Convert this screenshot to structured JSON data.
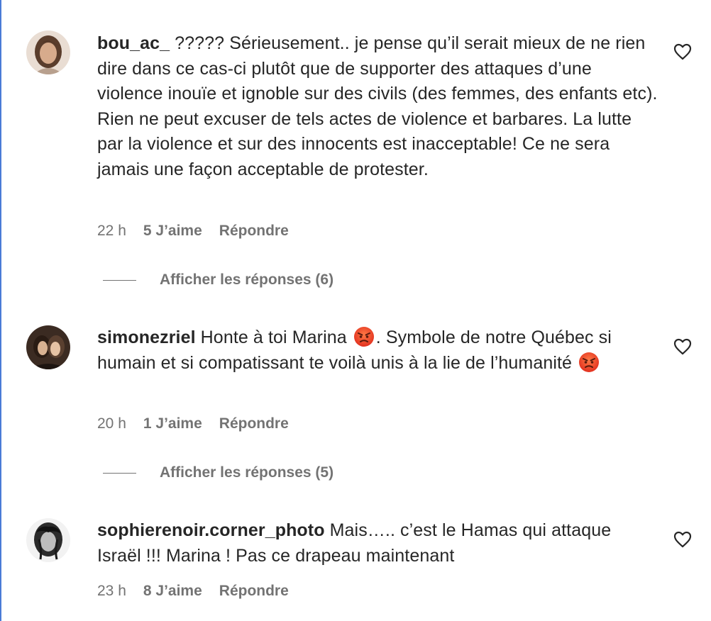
{
  "comments": [
    {
      "username": "bou_ac_",
      "text": "????? Sérieusement.. je pense qu’il serait mieux de ne rien dire dans ce cas-ci plutôt que de supporter des attaques d’une violence inouïe et ignoble sur des civils (des femmes, des enfants etc). Rien ne peut excuser de tels actes de violence et barbares. La lutte par la violence et sur des innocents est inacceptable! Ce ne sera jamais une façon acceptable de protester.",
      "time": "22 h",
      "likes": "5 J’aime",
      "reply": "Répondre",
      "replies_label": "Afficher les réponses (6)"
    },
    {
      "username": "simonezriel",
      "text_part1": "Honte à toi Marina",
      "emoji1": "angry-face",
      "text_part2": ". Symbole de notre Québec si humain et si compatissant te voilà unis à la lie de l’humanité",
      "emoji2": "angry-face",
      "time": "20 h",
      "likes": "1 J’aime",
      "reply": "Répondre",
      "replies_label": "Afficher les réponses (5)"
    },
    {
      "username": "sophierenoir.corner_photo",
      "text": "Mais….. c’est le Hamas qui attaque Israël !!! Marina ! Pas ce drapeau maintenant",
      "time": "23 h",
      "likes": "8 J’aime",
      "reply": "Répondre"
    }
  ],
  "colors": {
    "text": "#262626",
    "secondary": "#737373",
    "edge_accent": "#4a7bd6"
  },
  "icons": [
    "heart-outline-icon",
    "angry-face-emoji"
  ]
}
